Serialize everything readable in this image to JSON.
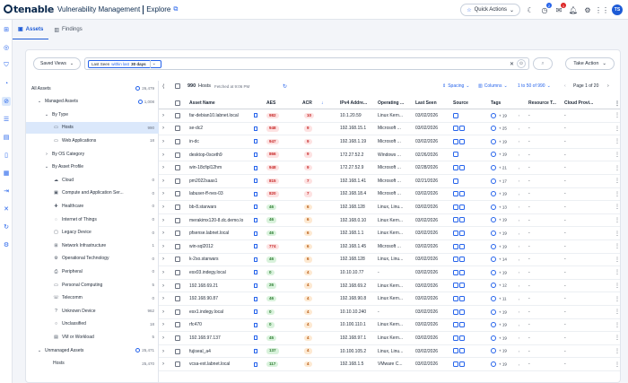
{
  "header": {
    "brand": "tenable",
    "product": "Vulnerability Management",
    "subproduct": "Explore",
    "quick_actions": "Quick Actions",
    "notif_badge_1": "2",
    "notif_badge_2": "1",
    "avatar": "TS"
  },
  "tabs": [
    {
      "label": "Assets"
    },
    {
      "label": "Findings"
    }
  ],
  "toolbar": {
    "saved_views": "Saved Views",
    "chip_field": "Last Seen",
    "chip_op": "within last",
    "chip_value": "30 days",
    "take_action": "Take Action"
  },
  "tree": [
    {
      "label": "All Assets",
      "count": "26,479",
      "indent": 0,
      "chev": "",
      "icon": "",
      "count_icon": true
    },
    {
      "label": "Managed Assets",
      "count": "1,008",
      "indent": 1,
      "chev": "⌄",
      "icon": "",
      "count_icon": true
    },
    {
      "label": "By Type",
      "count": "",
      "indent": 2,
      "chev": "⌄",
      "icon": "",
      "count_icon": false
    },
    {
      "label": "Hosts",
      "count": "990",
      "indent": 3,
      "chev": "",
      "icon": "▭",
      "count_icon": false,
      "selected": true
    },
    {
      "label": "Web Applications",
      "count": "18",
      "indent": 3,
      "chev": "",
      "icon": "▭",
      "count_icon": false
    },
    {
      "label": "By OS Category",
      "count": "",
      "indent": 2,
      "chev": "›",
      "icon": "",
      "count_icon": false
    },
    {
      "label": "By Asset Profile",
      "count": "",
      "indent": 2,
      "chev": "⌄",
      "icon": "",
      "count_icon": false
    },
    {
      "label": "Cloud",
      "count": "0",
      "indent": 3,
      "chev": "",
      "icon": "☁",
      "count_icon": false
    },
    {
      "label": "Compute and Application Ser...",
      "count": "0",
      "indent": 3,
      "chev": "",
      "icon": "▣",
      "count_icon": false
    },
    {
      "label": "Healthcare",
      "count": "0",
      "indent": 3,
      "chev": "",
      "icon": "✚",
      "count_icon": false
    },
    {
      "label": "Internet of Things",
      "count": "0",
      "indent": 3,
      "chev": "",
      "icon": "◌",
      "count_icon": false
    },
    {
      "label": "Legacy Device",
      "count": "0",
      "indent": 3,
      "chev": "",
      "icon": "▢",
      "count_icon": false
    },
    {
      "label": "Network Infrastructure",
      "count": "1",
      "indent": 3,
      "chev": "",
      "icon": "⊞",
      "count_icon": false
    },
    {
      "label": "Operational Technology",
      "count": "0",
      "indent": 3,
      "chev": "",
      "icon": "⚙",
      "count_icon": false
    },
    {
      "label": "Peripheral",
      "count": "0",
      "indent": 3,
      "chev": "",
      "icon": "⎙",
      "count_icon": false
    },
    {
      "label": "Personal Computing",
      "count": "5",
      "indent": 3,
      "chev": "",
      "icon": "▭",
      "count_icon": false
    },
    {
      "label": "Telecomm",
      "count": "0",
      "indent": 3,
      "chev": "",
      "icon": "☏",
      "count_icon": false
    },
    {
      "label": "Unknown Device",
      "count": "962",
      "indent": 3,
      "chev": "",
      "icon": "?",
      "count_icon": false
    },
    {
      "label": "Unclassified",
      "count": "18",
      "indent": 3,
      "chev": "",
      "icon": "○",
      "count_icon": false
    },
    {
      "label": "VM or Workload",
      "count": "5",
      "indent": 3,
      "chev": "",
      "icon": "▤",
      "count_icon": false
    },
    {
      "label": "Unmanaged Assets",
      "count": "25,471",
      "indent": 1,
      "chev": "⌄",
      "icon": "",
      "count_icon": true
    },
    {
      "label": "Hosts",
      "count": "25,470",
      "indent": 3,
      "chev": "",
      "icon": "",
      "count_icon": false
    }
  ],
  "table": {
    "count": "990",
    "count_label": "Hosts",
    "fetched": "Fetched at 9:06 PM",
    "spacing": "Spacing",
    "columns": "Columns",
    "range": "1 to 50 of 990",
    "page": "Page 1 of 20",
    "headers": [
      "Asset Name",
      "AES",
      "ACR",
      "IPv4 Addre...",
      "Operating ...",
      "Last Seen",
      "Source",
      "Tags",
      "Resource T...",
      "Cloud Provi..."
    ],
    "rows": [
      {
        "name": "far-debian10.labnet.local",
        "aes": "982",
        "acr": "10",
        "ip": "10.1.20.59",
        "os": "Linux Kern...",
        "seen": "03/02/2026",
        "src": 1,
        "tags": "+ 19",
        "res": "-",
        "cloud": "-"
      },
      {
        "name": "se-dc2",
        "aes": "948",
        "acr": "9",
        "ip": "192.168.15.1",
        "os": "Microsoft ...",
        "seen": "03/02/2026",
        "src": 2,
        "tags": "+ 25",
        "res": "-",
        "cloud": "-"
      },
      {
        "name": "in-dc",
        "aes": "947",
        "acr": "9",
        "ip": "192.168.1.19",
        "os": "Microsoft ...",
        "seen": "03/02/2026",
        "src": 2,
        "tags": "+ 19",
        "res": "-",
        "cloud": "-"
      },
      {
        "name": "desktop-0sceth9",
        "aes": "866",
        "acr": "9",
        "ip": "172.27.52.2",
        "os": "Windows ...",
        "seen": "02/26/2026",
        "src": 1,
        "tags": "+ 19",
        "res": "-",
        "cloud": "-"
      },
      {
        "name": "win-18cfipl12hm",
        "aes": "948",
        "acr": "9",
        "ip": "172.27.52.9",
        "os": "Microsoft ...",
        "seen": "02/28/2026",
        "src": 2,
        "tags": "+ 21",
        "res": "-",
        "cloud": "-"
      },
      {
        "name": "pm2022saas1",
        "aes": "815",
        "acr": "7",
        "ip": "192.168.1.41",
        "os": "Microsoft ...",
        "seen": "02/21/2026",
        "src": 1,
        "tags": "+ 17",
        "res": "-",
        "cloud": "-"
      },
      {
        "name": "labuser-ff-nes-03",
        "aes": "820",
        "acr": "7",
        "ip": "192.168.18.4",
        "os": "Microsoft ...",
        "seen": "03/02/2026",
        "src": 2,
        "tags": "+ 19",
        "res": "-",
        "cloud": "-"
      },
      {
        "name": "bb-8.starwars",
        "aes": "46",
        "acr": "6",
        "ip": "192.168.128",
        "os": "Linux, Linu...",
        "seen": "03/02/2026",
        "src": 2,
        "tags": "+ 13",
        "res": "-",
        "cloud": "-"
      },
      {
        "name": "merakimx120-8.dc.demo.lo",
        "aes": "46",
        "acr": "6",
        "ip": "192.168.0.10",
        "os": "Linux Kern...",
        "seen": "03/02/2026",
        "src": 2,
        "tags": "+ 19",
        "res": "-",
        "cloud": "-"
      },
      {
        "name": "pfsense.labnet.local",
        "aes": "46",
        "acr": "6",
        "ip": "192.168.1.1",
        "os": "Linux Kern...",
        "seen": "03/02/2026",
        "src": 2,
        "tags": "+ 19",
        "res": "-",
        "cloud": "-"
      },
      {
        "name": "win-sql2012",
        "aes": "774",
        "acr": "6",
        "ip": "192.168.1.45",
        "os": "Microsoft ...",
        "seen": "03/02/2026",
        "src": 2,
        "tags": "+ 19",
        "res": "-",
        "cloud": "-"
      },
      {
        "name": "k-2so.starwars",
        "aes": "46",
        "acr": "6",
        "ip": "192.168.128",
        "os": "Linux, Linu...",
        "seen": "03/02/2026",
        "src": 2,
        "tags": "+ 14",
        "res": "-",
        "cloud": "-"
      },
      {
        "name": "esx03.indegy.local",
        "aes": "0",
        "acr": "4",
        "ip": "10.10.10.77",
        "os": "-",
        "seen": "03/02/2026",
        "src": 2,
        "tags": "+ 19",
        "res": "-",
        "cloud": "-"
      },
      {
        "name": "192.168.69.21",
        "aes": "26",
        "acr": "4",
        "ip": "192.168.69.2",
        "os": "Linux Kern...",
        "seen": "03/02/2026",
        "src": 2,
        "tags": "+ 12",
        "res": "-",
        "cloud": "-"
      },
      {
        "name": "192.168.90.87",
        "aes": "46",
        "acr": "4",
        "ip": "192.168.90.8",
        "os": "Linux Kern...",
        "seen": "03/02/2026",
        "src": 2,
        "tags": "+ 11",
        "res": "-",
        "cloud": "-"
      },
      {
        "name": "esx1.indegy.local",
        "aes": "0",
        "acr": "4",
        "ip": "10.10.10.240",
        "os": "-",
        "seen": "03/02/2026",
        "src": 2,
        "tags": "+ 19",
        "res": "-",
        "cloud": "-"
      },
      {
        "name": "rfc470",
        "aes": "0",
        "acr": "4",
        "ip": "10.100.110.1",
        "os": "Linux Kern...",
        "seen": "03/02/2026",
        "src": 2,
        "tags": "+ 19",
        "res": "-",
        "cloud": "-"
      },
      {
        "name": "192.168.97.137",
        "aes": "45",
        "acr": "4",
        "ip": "192.168.97.1",
        "os": "Linux Kern...",
        "seen": "03/02/2026",
        "src": 2,
        "tags": "+ 19",
        "res": "-",
        "cloud": "-"
      },
      {
        "name": "fujiseal_a4",
        "aes": "137",
        "acr": "4",
        "ip": "10.100.105.2",
        "os": "Linux, Linu...",
        "seen": "03/02/2026",
        "src": 2,
        "tags": "+ 19",
        "res": "-",
        "cloud": "-"
      },
      {
        "name": "vcsa-ext.labnet.local",
        "aes": "117",
        "acr": "4",
        "ip": "192.168.1.5",
        "os": "VMware C...",
        "seen": "03/02/2026",
        "src": 2,
        "tags": "+ 19",
        "res": "-",
        "cloud": "-"
      }
    ]
  },
  "colors": {
    "accent": "#1d5bd6",
    "aes_high": "#fde2e2",
    "aes_high_text": "#c62828",
    "aes_low": "#d9f2dc",
    "aes_low_text": "#2e7d32",
    "acr_bg": "#fde2e2",
    "acr_high_text": "#c62828",
    "acr_mid_bg": "#fde9d2",
    "acr_mid_text": "#b45309"
  }
}
